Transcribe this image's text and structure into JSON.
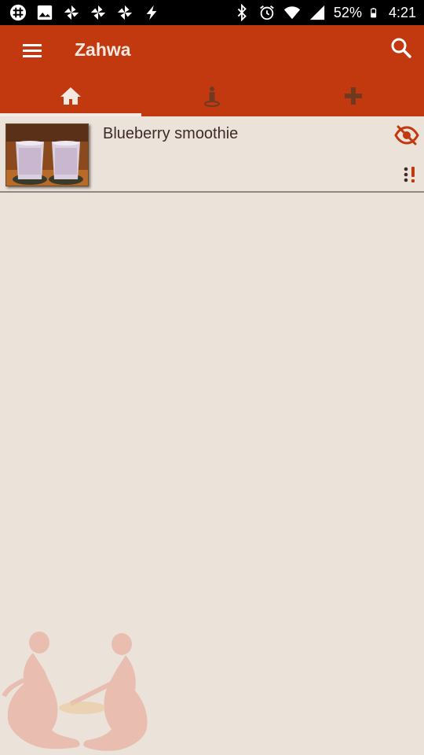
{
  "status_bar": {
    "battery": "52%",
    "time": "4:21",
    "left_icons": [
      "slack-icon",
      "image-icon",
      "pinwheel-icon",
      "pinwheel-icon",
      "pinwheel-icon",
      "bolt-icon"
    ],
    "right_icons": [
      "bluetooth-icon",
      "alarm-icon",
      "wifi-icon",
      "signal-icon",
      "battery-icon"
    ]
  },
  "app_bar": {
    "title": "Zahwa",
    "menu_icon": "hamburger-menu-icon",
    "search_icon": "search-icon"
  },
  "tabs": [
    {
      "icon": "home-icon",
      "active": true
    },
    {
      "icon": "person-pin-icon",
      "active": false
    },
    {
      "icon": "plus-icon",
      "active": false
    }
  ],
  "recipes": [
    {
      "title": "Blueberry smoothie",
      "hide_icon": "eye-off-icon",
      "more_icon": "more-alert-icon"
    }
  ],
  "colors": {
    "primary": "#c2380f",
    "background": "#ebe3da",
    "text": "#3e2a28",
    "inactive_tab_icon": "#6e3a22"
  }
}
